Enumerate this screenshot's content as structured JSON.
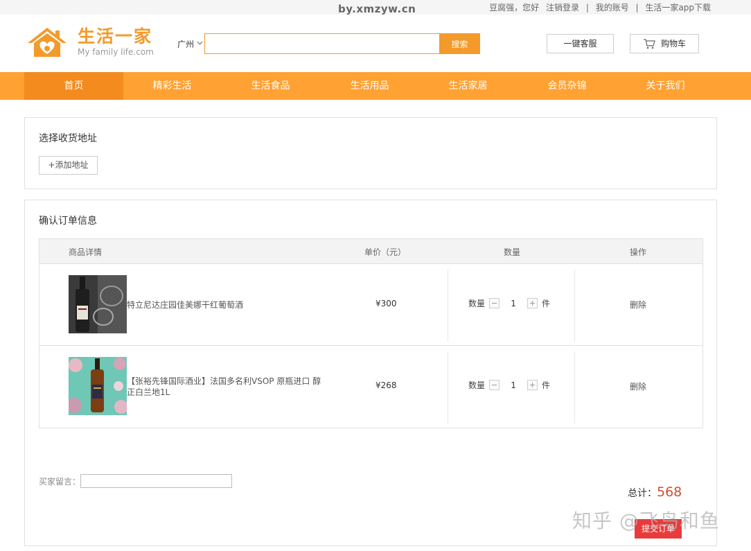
{
  "watermark_top": "by.xmzyw.cn",
  "top_links": {
    "greeting": "豆腐强，您好",
    "logout": "注销登录",
    "sep": "|",
    "my_account": "我的账号",
    "app_download": "生活一家app下载"
  },
  "logo": {
    "cn": "生活一家",
    "en": "My family life.com"
  },
  "city": "广州",
  "search": {
    "placeholder": "",
    "button": "搜索"
  },
  "header_buttons": {
    "service": "一键客服",
    "cart": "购物车"
  },
  "nav": [
    "首页",
    "精彩生活",
    "生活食品",
    "生活用品",
    "生活家居",
    "会员杂锦",
    "关于我们"
  ],
  "address_panel": {
    "title": "选择收货地址",
    "add_button": "+添加地址"
  },
  "order_panel": {
    "title": "确认订单信息",
    "columns": [
      "商品详情",
      "单价（元）",
      "数量",
      "操作"
    ],
    "items": [
      {
        "name": "特立尼达庄园佳美娜干红葡萄酒",
        "price": "¥300",
        "qty_label": "数量",
        "qty": "1",
        "unit": "件",
        "action": "删除"
      },
      {
        "name": "【张裕先锋国际酒业】法国多名利VSOP 原瓶进口 醇正白兰地1L",
        "price": "¥268",
        "qty_label": "数量",
        "qty": "1",
        "unit": "件",
        "action": "删除"
      }
    ],
    "message_label": "买家留言：",
    "total_label": "总计：",
    "total_value": "568",
    "submit": "提交订单"
  },
  "watermark_bottom": "知乎 @飞鸟和鱼",
  "colors": {
    "brand": "#f39a2b",
    "nav": "#ffa133",
    "nav_active": "#f48b1e",
    "price_total": "#d64b2e",
    "submit": "#e93b3b"
  }
}
